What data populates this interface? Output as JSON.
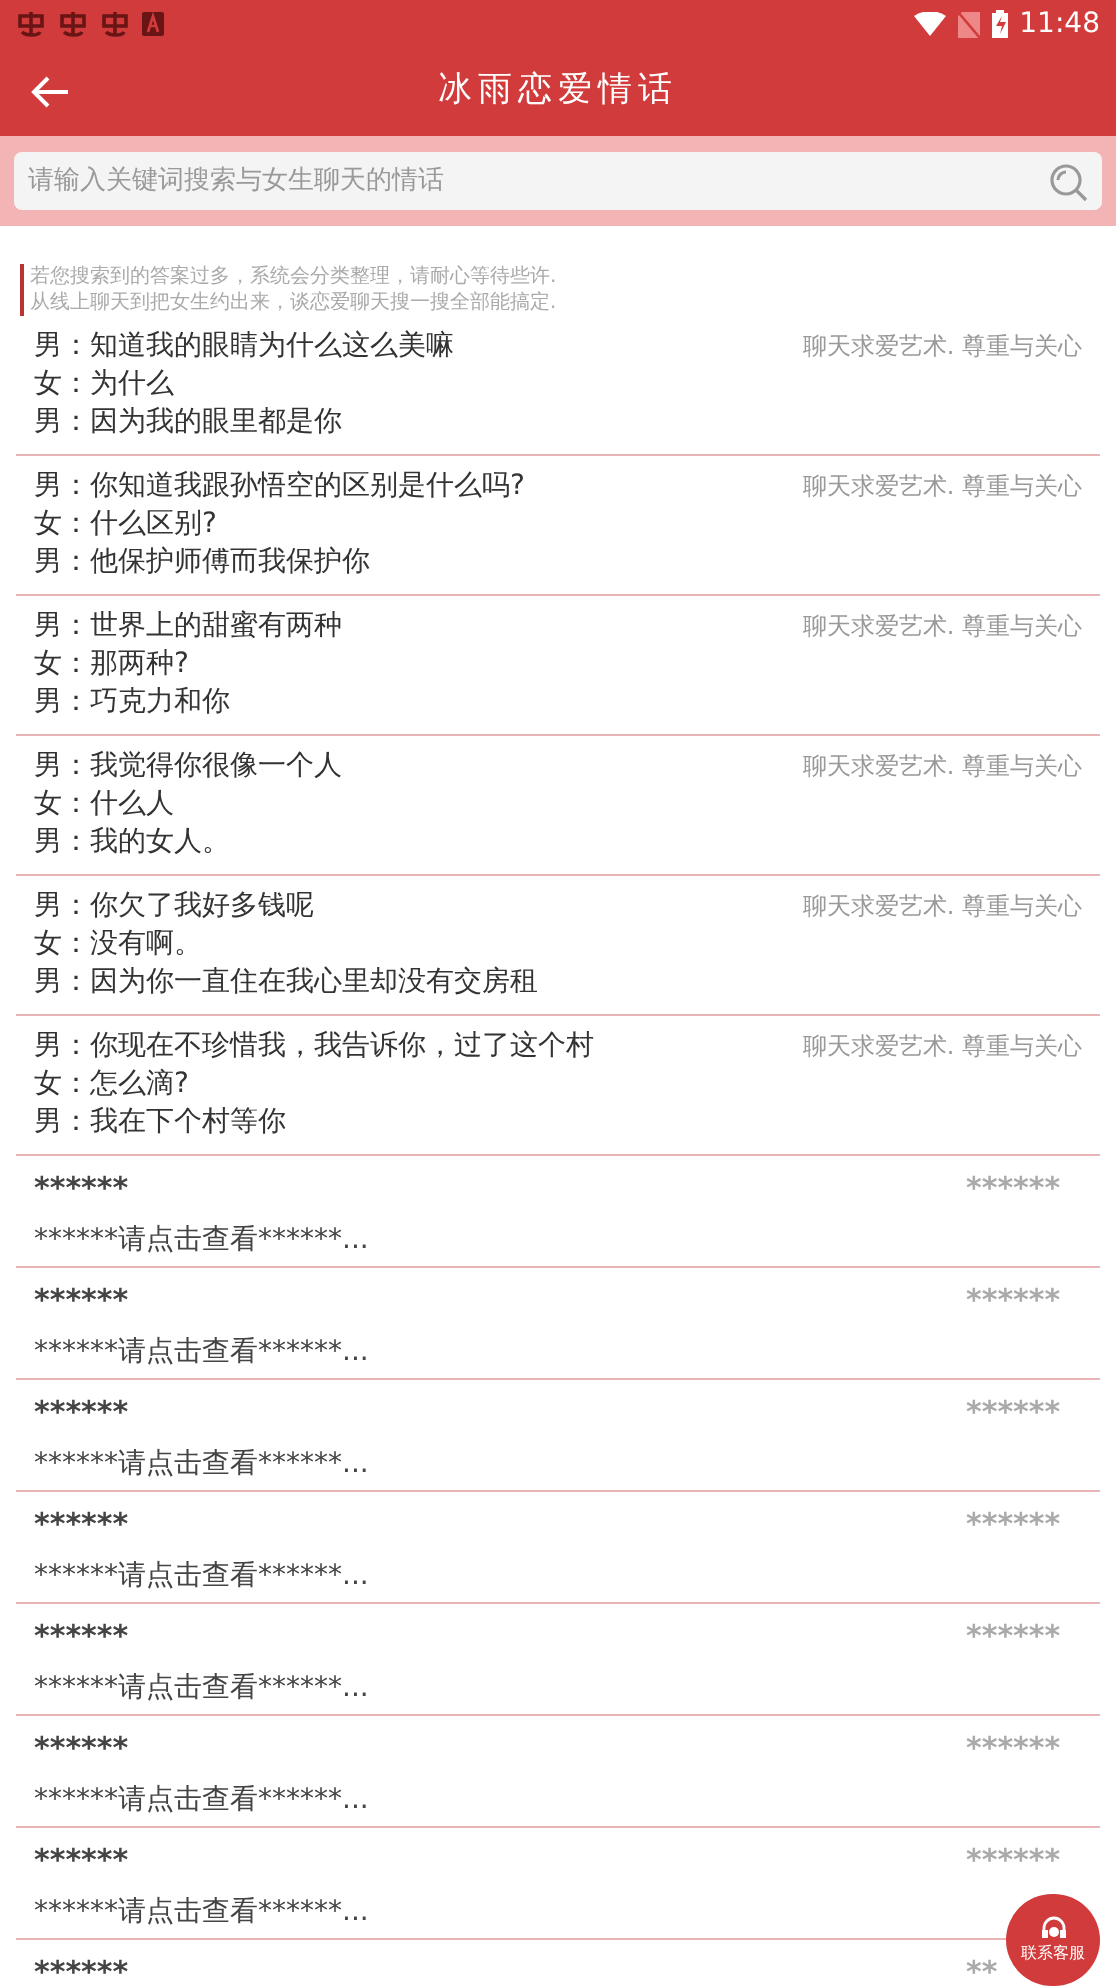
{
  "status_bar": {
    "time": "11:48"
  },
  "header": {
    "title": "冰雨恋爱情话"
  },
  "search": {
    "placeholder": "请输入关键词搜索与女生聊天的情话"
  },
  "notice": [
    "若您搜索到的答案过多，系统会分类整理，请耐心等待些许.",
    "从线上聊天到把女生约出来，谈恋爱聊天搜一搜全部能搞定."
  ],
  "items": [
    {
      "kind": "dialogue",
      "lines": [
        "男：知道我的眼睛为什么这么美嘛",
        "女：为什么",
        "男：因为我的眼里都是你"
      ],
      "tag": "聊天求爱艺术. 尊重与关心"
    },
    {
      "kind": "dialogue",
      "lines": [
        "男：你知道我跟孙悟空的区别是什么吗?",
        "女：什么区别?",
        "男：他保护师傅而我保护你"
      ],
      "tag": "聊天求爱艺术. 尊重与关心"
    },
    {
      "kind": "dialogue",
      "lines": [
        "男：世界上的甜蜜有两种",
        "女：那两种?",
        "男：巧克力和你"
      ],
      "tag": "聊天求爱艺术. 尊重与关心"
    },
    {
      "kind": "dialogue",
      "lines": [
        "男：我觉得你很像一个人",
        "女：什么人",
        "男：我的女人。"
      ],
      "tag": "聊天求爱艺术. 尊重与关心"
    },
    {
      "kind": "dialogue",
      "lines": [
        "男：你欠了我好多钱呢",
        "女：没有啊。",
        "男：因为你一直住在我心里却没有交房租"
      ],
      "tag": "聊天求爱艺术. 尊重与关心"
    },
    {
      "kind": "dialogue",
      "lines": [
        "男：你现在不珍惜我，我告诉你，过了这个村",
        "女：怎么滴?",
        "男：我在下个村等你"
      ],
      "tag": "聊天求爱艺术. 尊重与关心"
    },
    {
      "kind": "locked",
      "title": "******",
      "tag": "******",
      "preview": "******请点击查看******..."
    },
    {
      "kind": "locked",
      "title": "******",
      "tag": "******",
      "preview": "******请点击查看******..."
    },
    {
      "kind": "locked",
      "title": "******",
      "tag": "******",
      "preview": "******请点击查看******..."
    },
    {
      "kind": "locked",
      "title": "******",
      "tag": "******",
      "preview": "******请点击查看******..."
    },
    {
      "kind": "locked",
      "title": "******",
      "tag": "******",
      "preview": "******请点击查看******..."
    },
    {
      "kind": "locked",
      "title": "******",
      "tag": "******",
      "preview": "******请点击查看******..."
    },
    {
      "kind": "locked",
      "title": "******",
      "tag": "******",
      "preview": "******请点击查看******..."
    },
    {
      "kind": "locked",
      "title": "******",
      "tag": "**"
    }
  ],
  "service_button": {
    "label": "联系客服"
  }
}
